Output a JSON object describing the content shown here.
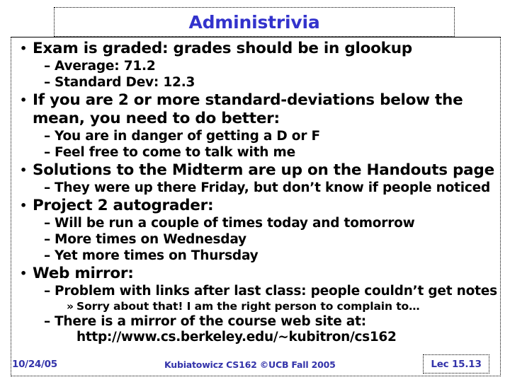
{
  "slide": {
    "title": "Administrivia",
    "title_color": "#3333CC",
    "footer_color": "#3333AA",
    "body_text_color": "#000000"
  },
  "bullets": [
    {
      "level": 1,
      "marker": "•",
      "text": "Exam is graded: grades should be in glookup"
    },
    {
      "level": 2,
      "marker": "–",
      "text": "Average: 71.2"
    },
    {
      "level": 2,
      "marker": "–",
      "text": "Standard Dev: 12.3"
    },
    {
      "level": 1,
      "marker": "•",
      "text": "If you are 2 or more standard-deviations below the mean, you need to do better:"
    },
    {
      "level": 2,
      "marker": "–",
      "text": "You are in danger of getting a D or F"
    },
    {
      "level": 2,
      "marker": "–",
      "text": "Feel free to come to talk with me"
    },
    {
      "level": 1,
      "marker": "•",
      "text": "Solutions to the Midterm are up on the Handouts page"
    },
    {
      "level": 2,
      "marker": "–",
      "text": "They were up there Friday, but don’t know if people noticed"
    },
    {
      "level": 1,
      "marker": "•",
      "text": "Project 2 autograder:"
    },
    {
      "level": 2,
      "marker": "–",
      "text": "Will be run a couple of times today and tomorrow"
    },
    {
      "level": 2,
      "marker": "–",
      "text": "More times on Wednesday"
    },
    {
      "level": 2,
      "marker": "–",
      "text": "Yet more times on Thursday"
    },
    {
      "level": 1,
      "marker": "•",
      "text": "Web mirror:"
    },
    {
      "level": 2,
      "marker": "–",
      "text": "Problem with links after last class: people couldn’t get notes"
    },
    {
      "level": 3,
      "marker": "»",
      "text": "Sorry about that! I am the right person to complain to…"
    },
    {
      "level": 2,
      "marker": "–",
      "text": "There is a mirror of the course web site at:"
    },
    {
      "level": 0,
      "marker": "",
      "text": "http://www.cs.berkeley.edu/~kubitron/cs162"
    }
  ],
  "footer": {
    "date": "10/24/05",
    "center": "Kubiatowicz CS162 ©UCB Fall 2005",
    "lecture": "Lec 15.13"
  }
}
